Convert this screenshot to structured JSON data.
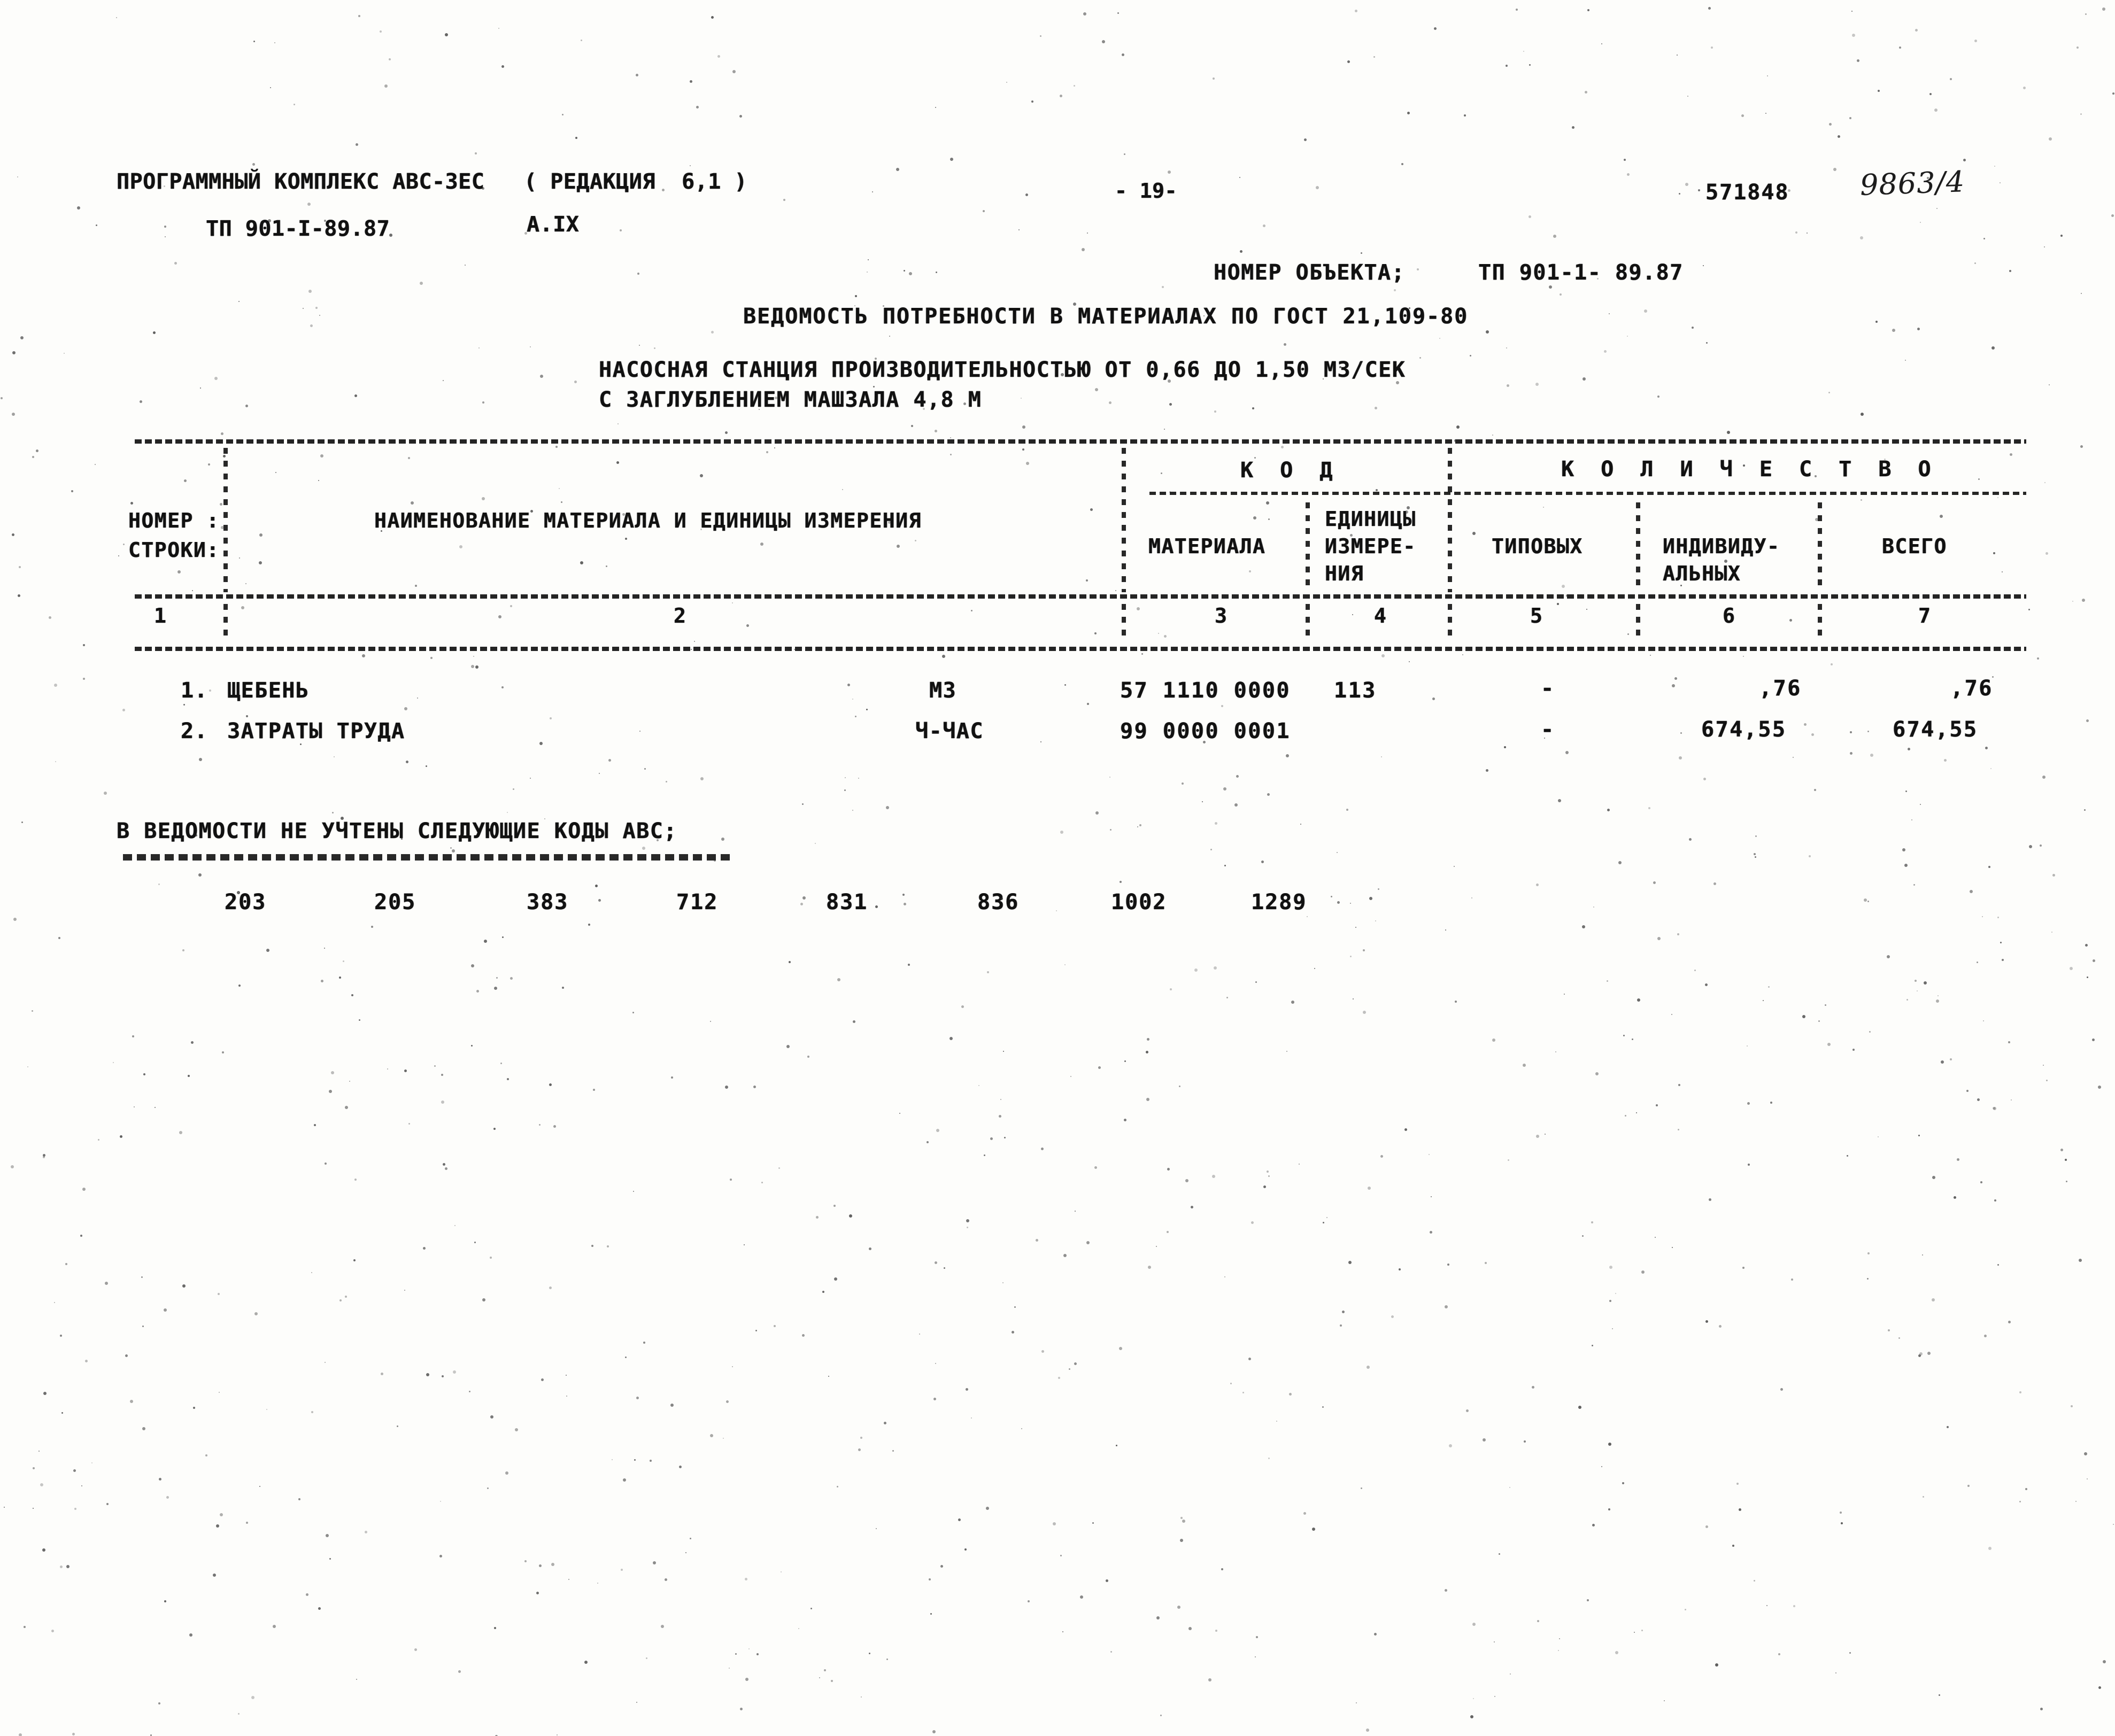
{
  "document": {
    "kind": "print-listing",
    "ink_color": "#111111",
    "paper_color": "#fdfdfb"
  },
  "header": {
    "software_line": "ПРОГРАММНЫЙ КОМПЛЕКС АВС-3ЕС   ( РЕДАКЦИЯ  6,1 )",
    "project_code": "ТП 901-I-89.87",
    "section_code": "А.IX",
    "page_number": "- 19-",
    "sheet_number": "571848",
    "handwritten_mark": "9863/4"
  },
  "object": {
    "label": "НОМЕР ОБЪЕКТА;",
    "value": "ТП 901-1- 89.87"
  },
  "titles": {
    "main": "ВЕДОМОСТЬ ПОТРЕБНОСТИ В МАТЕРИАЛАХ ПО ГОСТ 21,109-80",
    "subtitle_1": "НАСОСНАЯ СТАНЦИЯ ПРОИЗВОДИТЕЛЬНОСТЬЮ ОТ 0,66 ДО 1,50 М3/СЕК",
    "subtitle_2": "С ЗАГЛУБЛЕНИЕМ МАШЗАЛА 4,8 М"
  },
  "table": {
    "group_headers": {
      "code": "К О Д",
      "quantity": "К О Л И Ч Е С Т В О"
    },
    "headers": {
      "row_number_1": "НОМЕР :",
      "row_number_2": "СТРОКИ:",
      "name": "НАИМЕНОВАНИЕ МАТЕРИАЛА И ЕДИНИЦЫ ИЗМЕРЕНИЯ",
      "code_material": "МАТЕРИАЛА",
      "code_unit_1": "ЕДИНИЦЫ",
      "code_unit_2": "ИЗМЕРЕ-",
      "code_unit_3": "НИЯ",
      "qty_typical": "ТИПОВЫХ",
      "qty_individual_1": "ИНДИВИДУ-",
      "qty_individual_2": "АЛЬНЫХ",
      "qty_total": "ВСЕГО"
    },
    "column_numbers": [
      "1",
      "2",
      "3",
      "4",
      "5",
      "6",
      "7"
    ],
    "rows": [
      {
        "line_no": "1.",
        "name": "ЩЕБЕНЬ",
        "unit": "М3",
        "code_material": "57 1110 0000",
        "code_unit": "113",
        "qty_typical": "-",
        "qty_individual": ",76",
        "qty_total": ",76"
      },
      {
        "line_no": "2.",
        "name": "ЗАТРАТЫ ТРУДА",
        "unit": "Ч-ЧАС",
        "code_material": "99 0000 0001",
        "code_unit": "",
        "qty_typical": "-",
        "qty_individual": "674,55",
        "qty_total": "674,55"
      }
    ]
  },
  "footer": {
    "note_title": "В ВЕДОМОСТИ НЕ УЧТЕНЫ СЛЕДУЮЩИЕ КОДЫ АВС;",
    "separator": "==========================================",
    "codes": [
      "203",
      "205",
      "383",
      "712",
      "831",
      "836",
      "1002",
      "1289"
    ]
  }
}
